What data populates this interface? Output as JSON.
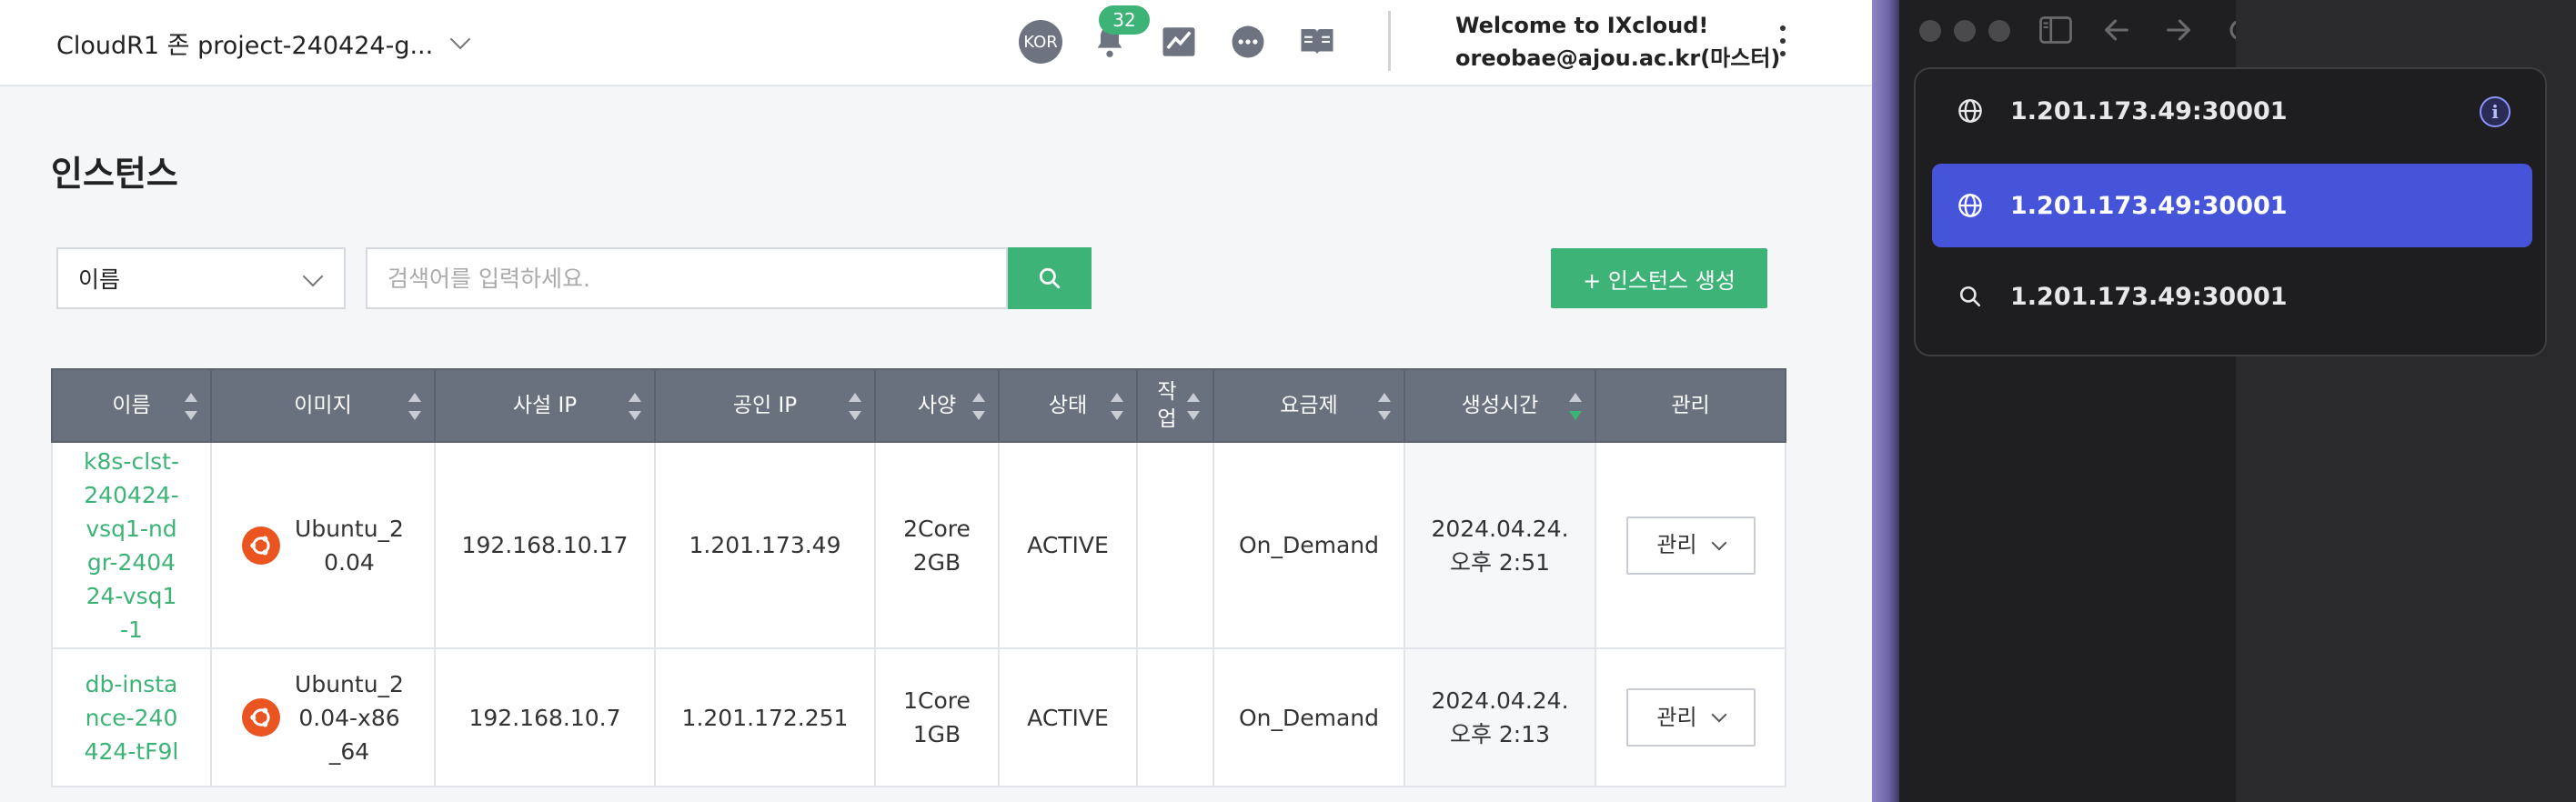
{
  "topbar": {
    "project_label": "CloudR1 존 project-240424-g...",
    "language_badge": "KOR",
    "notification_count": "32",
    "icons": [
      "bell-icon",
      "chart-icon",
      "chat-icon",
      "book-icon"
    ],
    "welcome_line1": "Welcome to IXcloud!",
    "welcome_line2": "oreobae@ajou.ac.kr(마스터)"
  },
  "page": {
    "title": "인스턴스"
  },
  "filter": {
    "field_value": "이름",
    "search_placeholder": "검색어를 입력하세요.",
    "search_value": "",
    "create_button": "+ 인스턴스 생성"
  },
  "table": {
    "headers": [
      "이름",
      "이미지",
      "사설 IP",
      "공인 IP",
      "사양",
      "상태",
      "작업",
      "요금제",
      "생성시간",
      "관리"
    ],
    "rows": [
      {
        "name": "k8s-clst-240424-vsq1-ndgr-240424-vsq1-1",
        "image": "Ubuntu_20.04",
        "private_ip": "192.168.10.17",
        "public_ip": "1.201.173.49",
        "spec": "2Core 2GB",
        "status": "ACTIVE",
        "task": "",
        "plan": "On_Demand",
        "created_date": "2024.04.24.",
        "created_time": "오후 2:51",
        "manage": "관리"
      },
      {
        "name": "db-instance-240424-tF9l",
        "image": "Ubuntu_20.04-x86_64",
        "private_ip": "192.168.10.7",
        "public_ip": "1.201.172.251",
        "spec": "1Core 1GB",
        "status": "ACTIVE",
        "task": "",
        "plan": "On_Demand",
        "created_date": "2024.04.24.",
        "created_time": "오후 2:13",
        "manage": "관리"
      }
    ]
  },
  "browser": {
    "suggestions": [
      {
        "text": "1.201.173.49:30001",
        "icon": "globe-icon",
        "active": false
      },
      {
        "text": "1.201.173.49:30001",
        "icon": "globe-icon",
        "active": true
      },
      {
        "text": "1.201.173.49:30001",
        "icon": "search-icon",
        "active": false
      }
    ]
  },
  "colors": {
    "accent_green": "#3db377",
    "table_header": "#68717d",
    "selection_blue": "#4654d9",
    "ubuntu_orange": "#e95420"
  }
}
